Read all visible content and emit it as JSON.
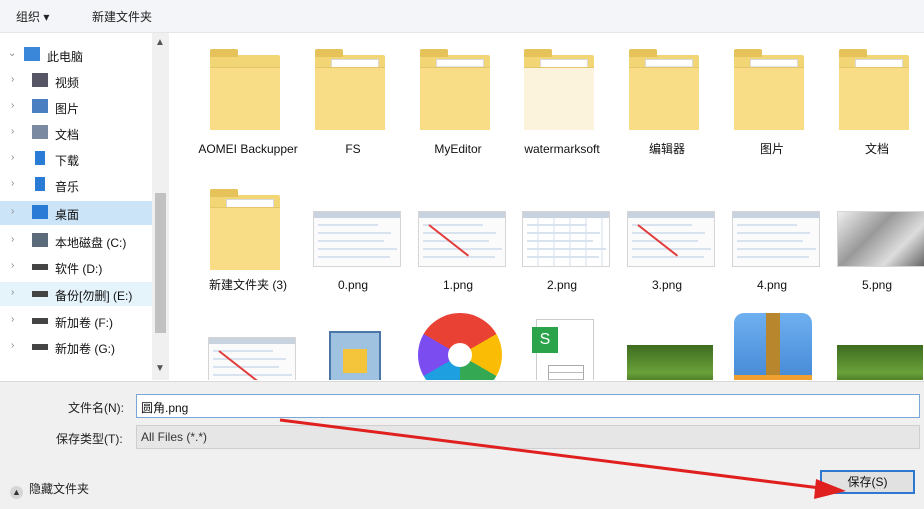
{
  "toolbar": {
    "organize": "组织 ▾",
    "new_folder": "新建文件夹"
  },
  "nav": [
    {
      "label": "此电脑",
      "icon": "pc-icon",
      "chev": "⌄"
    },
    {
      "label": "视频",
      "icon": "video-icon",
      "chev": "›"
    },
    {
      "label": "图片",
      "icon": "pictures-icon",
      "chev": "›"
    },
    {
      "label": "文档",
      "icon": "document-icon",
      "chev": "›"
    },
    {
      "label": "下载",
      "icon": "download-icon",
      "chev": "›"
    },
    {
      "label": "音乐",
      "icon": "music-icon",
      "chev": "›"
    },
    {
      "label": "桌面",
      "icon": "desktop-icon",
      "chev": "›"
    },
    {
      "label": "本地磁盘 (C:)",
      "icon": "disk-icon",
      "chev": "›"
    },
    {
      "label": "软件 (D:)",
      "icon": "drive-icon",
      "chev": "›"
    },
    {
      "label": "备份[勿删] (E:)",
      "icon": "drive-icon",
      "chev": "›"
    },
    {
      "label": "新加卷 (F:)",
      "icon": "drive-icon",
      "chev": "›"
    },
    {
      "label": "新加卷 (G:)",
      "icon": "drive-icon",
      "chev": "›"
    }
  ],
  "files": [
    {
      "label": "AOMEI Backupper",
      "kind": "folder"
    },
    {
      "label": "FS",
      "kind": "folder-doc"
    },
    {
      "label": "MyEditor",
      "kind": "folder-docs"
    },
    {
      "label": "watermarksoft",
      "kind": "folder-white"
    },
    {
      "label": "编辑器",
      "kind": "folder-docs"
    },
    {
      "label": "图片",
      "kind": "folder-docs"
    },
    {
      "label": "文档",
      "kind": "folder-pic"
    },
    {
      "label": "新建文件夹 (3)",
      "kind": "folder-pic"
    },
    {
      "label": "0.png",
      "kind": "shot"
    },
    {
      "label": "1.png",
      "kind": "shot-red"
    },
    {
      "label": "2.png",
      "kind": "shot-grid"
    },
    {
      "label": "3.png",
      "kind": "shot-red"
    },
    {
      "label": "4.png",
      "kind": "shot-doc"
    },
    {
      "label": "5.png",
      "kind": "shot-dark"
    },
    {
      "label": "",
      "kind": "shot-partial"
    },
    {
      "label": "",
      "kind": "installer-icon"
    },
    {
      "label": "",
      "kind": "pinwheel-icon"
    },
    {
      "label": "",
      "kind": "sheet-icon"
    },
    {
      "label": "",
      "kind": "photo-grass"
    },
    {
      "label": "",
      "kind": "archive-icon"
    },
    {
      "label": "",
      "kind": "photo-grass"
    }
  ],
  "form": {
    "filename_label": "文件名(N):",
    "filename_value": "圆角.png",
    "filetype_label": "保存类型(T):",
    "filetype_value": "All Files (*.*)",
    "hide_folders": "隐藏文件夹",
    "save": "保存(S)"
  },
  "colors": {
    "accent": "#2f78d1",
    "selection": "#cce4f7",
    "annotation": "#e0201f"
  }
}
